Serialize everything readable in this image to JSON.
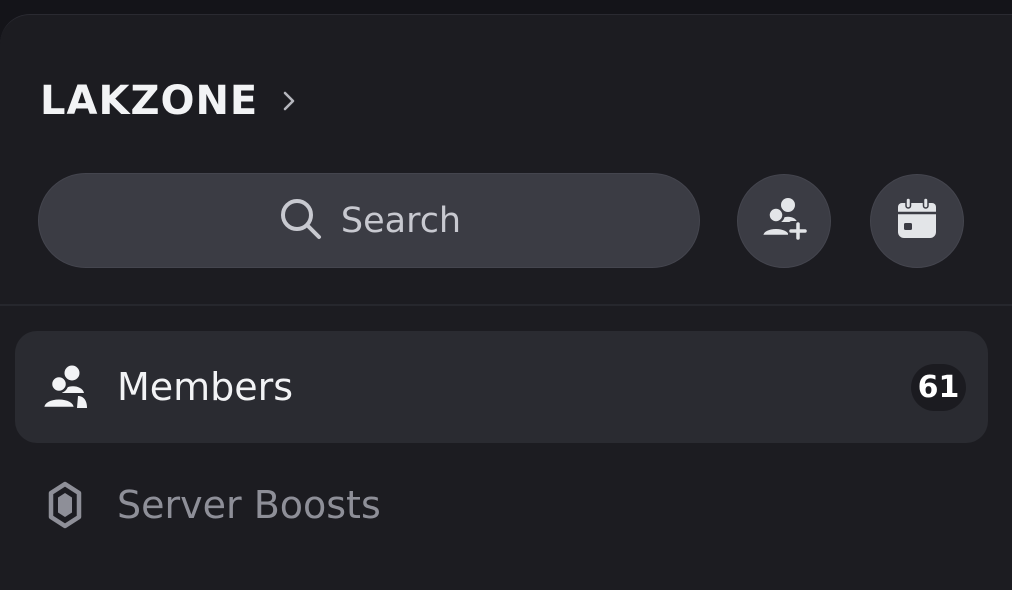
{
  "server": {
    "name": "LAKZONE",
    "chevron_icon": "chevron-right-icon"
  },
  "search": {
    "label": "Search",
    "icon": "search-icon"
  },
  "actions": [
    {
      "id": "invite",
      "icon": "add-member-icon"
    },
    {
      "id": "events",
      "icon": "calendar-icon"
    }
  ],
  "channels": {
    "members": {
      "label": "Members",
      "count": "61",
      "icon": "members-icon"
    },
    "server_boosts": {
      "label": "Server Boosts",
      "icon": "boost-gem-icon"
    }
  },
  "colors": {
    "background": "#1c1c21",
    "surface": "#3b3c44",
    "selected_row": "#2a2b31",
    "text_primary": "#f2f3f5",
    "text_muted": "#8e8f98"
  }
}
